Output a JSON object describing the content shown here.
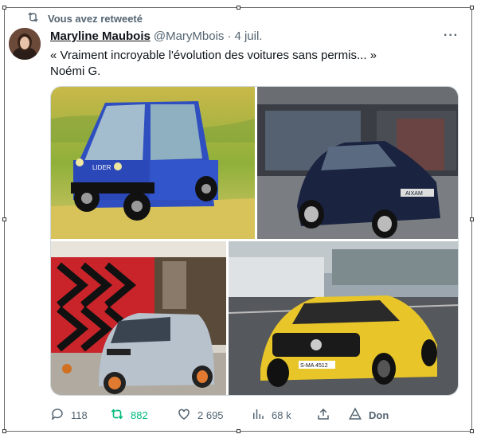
{
  "retweet_label": "Vous avez retweeté",
  "tweet": {
    "author_name": "Maryline Maubois",
    "author_handle": "@MaryMbois",
    "separator": "·",
    "date": "4 juil.",
    "text": "« Vraiment incroyable l'évolution des voitures sans permis... »\nNoémi G.",
    "more_label": "···"
  },
  "media": {
    "images": [
      "blue-microcar-lider-image",
      "dark-blue-aixam-microcar-image",
      "citroen-ami-image",
      "yellow-mercedes-amg-image"
    ],
    "plate_text": "S-MA 4512"
  },
  "actions": {
    "reply": "118",
    "retweet": "882",
    "like": "2 695",
    "views": "68 k",
    "share": "",
    "don": "Don"
  },
  "colors": {
    "retweet_active": "#00ba7c",
    "secondary_text": "#536471",
    "primary_text": "#0f1419",
    "yellow_car": "#e8c528",
    "blue_car": "#2f4fc0"
  }
}
